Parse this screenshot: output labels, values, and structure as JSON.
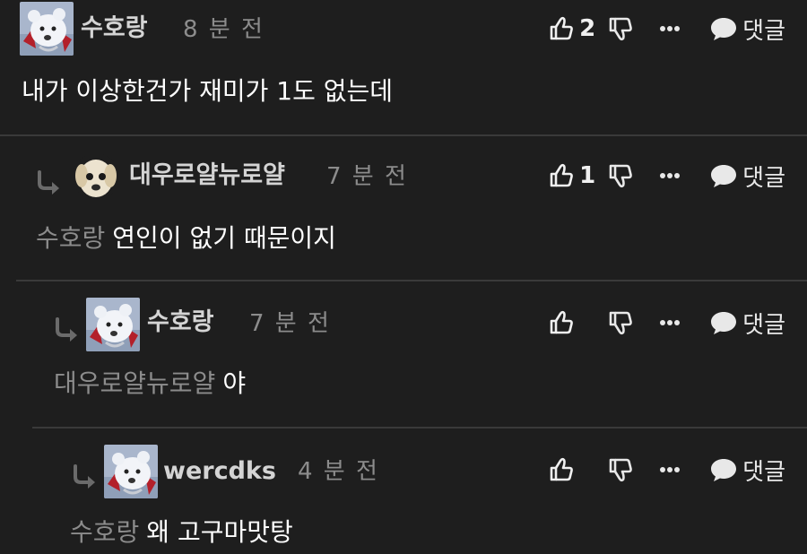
{
  "comments": [
    {
      "author": "수호랑",
      "time": "8 분 전",
      "likes": "2",
      "mention": "",
      "text": "내가 이상한건가 재미가 1도 없는데",
      "reply_label": "댓글",
      "avatar_icon": "polar-bear-avatar"
    },
    {
      "author": "대우로얄뉴로얄",
      "time": "7 분 전",
      "likes": "1",
      "mention": "수호랑",
      "text": "연인이 없기 때문이지",
      "reply_label": "댓글",
      "avatar_icon": "puppy-avatar"
    },
    {
      "author": "수호랑",
      "time": "7 분 전",
      "likes": "",
      "mention": "대우로얄뉴로얄",
      "text": "야",
      "reply_label": "댓글",
      "avatar_icon": "polar-bear-avatar"
    },
    {
      "author": "wercdks",
      "time": "4 분 전",
      "likes": "",
      "mention": "수호랑",
      "text": "왜 고구마맛탕",
      "reply_label": "댓글",
      "avatar_icon": "polar-bear-avatar"
    }
  ],
  "colors": {
    "background": "#1e1e1e",
    "author": "#d4d4d4",
    "muted": "#8c8c8c",
    "divider": "#3a3a3a"
  }
}
